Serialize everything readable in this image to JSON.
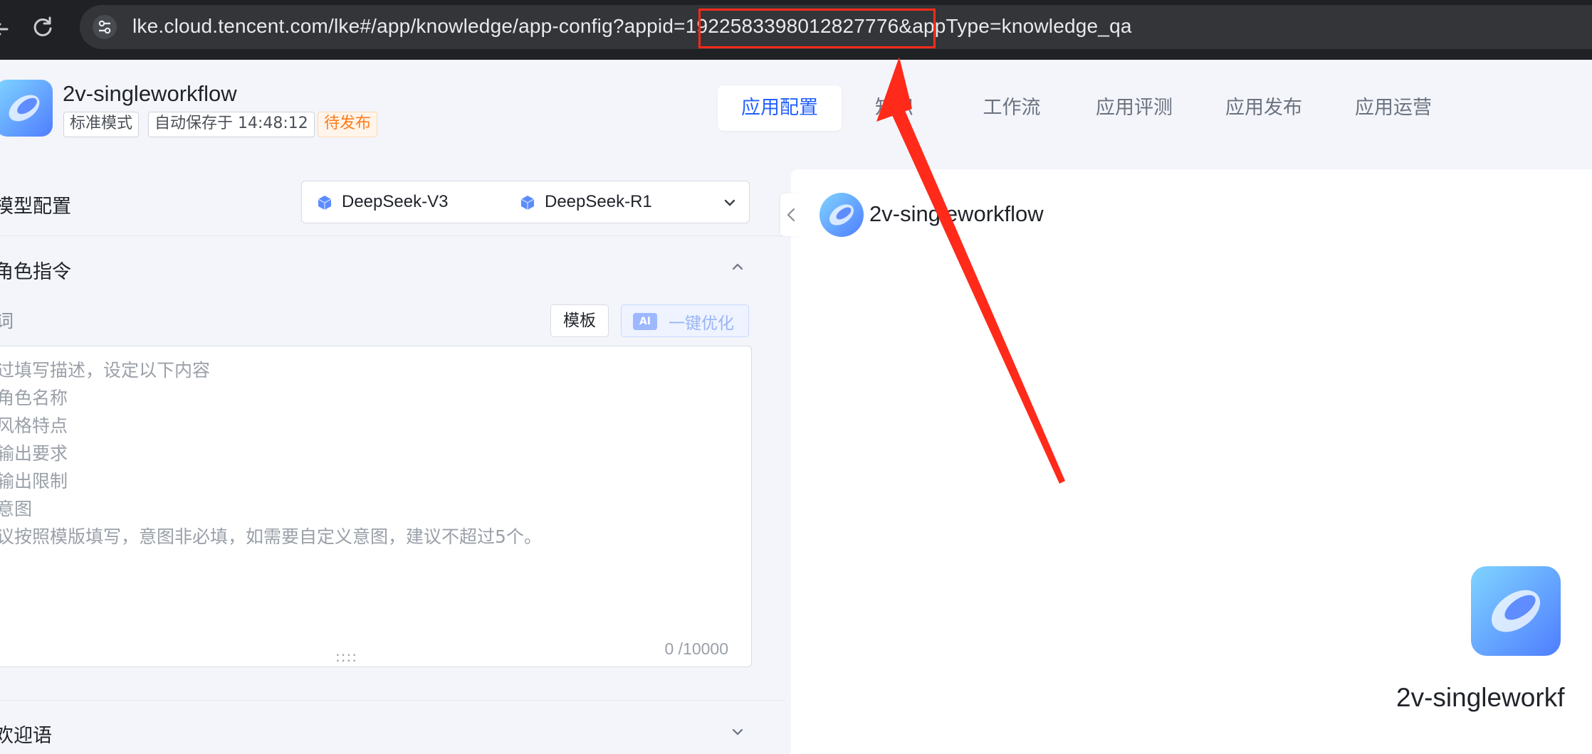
{
  "browser": {
    "url_prefix": "lke.cloud.tencent.com/lke#/app/knowledge/app-config?appid",
    "url_appid": "=1922583398012827776",
    "url_suffix": "&appType=knowledge_qa"
  },
  "header": {
    "app_name": "2v-singleworkflow",
    "tags": [
      "标准模式",
      "自动保存于 14:48:12",
      "待发布"
    ],
    "tabs": [
      "应用配置",
      "知识",
      "工作流",
      "应用评测",
      "应用发布",
      "应用运营"
    ]
  },
  "left": {
    "model_config_title": "模型配置",
    "models": [
      "DeepSeek-V3",
      "DeepSeek-R1"
    ],
    "role_title": "角色指令",
    "prompt_label": "词",
    "template_button": "模板",
    "optimize_ai_badge": "AI",
    "optimize_button": "一键优化",
    "placeholder_lines": [
      "过填写描述，设定以下内容",
      "角色名称",
      "风格特点",
      "输出要求",
      "输出限制",
      "意图",
      "议按照模版填写，意图非必填，如需要自定义意图，建议不超过5个。"
    ],
    "resize_grip": "::::",
    "counter": "0 /10000",
    "welcome_title": "欢迎语"
  },
  "right": {
    "chat_title": "2v-singleworkflow",
    "welcome_name": "2v-singleworkf"
  },
  "colors": {
    "accent": "#2461ff",
    "warning": "#ff7a1a",
    "annotation": "#ff2a1a"
  }
}
